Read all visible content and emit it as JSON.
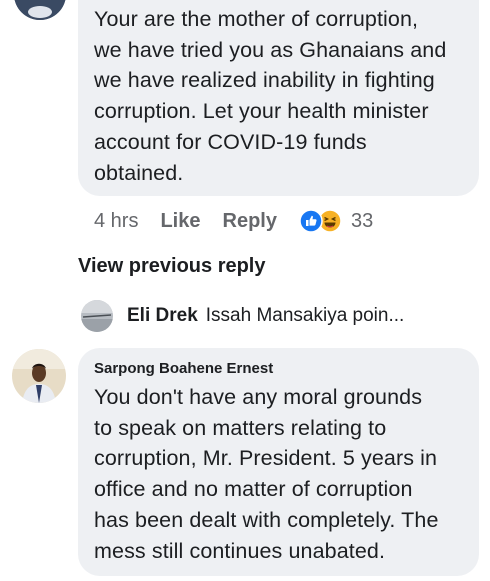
{
  "comment_1": {
    "lines": [
      "Your are the mother of corruption,",
      "we have tried you as Ghanaians and",
      "we have realized  inability in fighting",
      "corruption. Let your health minister",
      "account for COVID-19 funds",
      "obtained."
    ],
    "time": "4 hrs",
    "like_label": "Like",
    "reply_label": "Reply",
    "reaction_icons": [
      "like-reaction-icon",
      "haha-reaction-icon"
    ],
    "reaction_count": "33"
  },
  "view_previous_reply": "View previous reply",
  "collapsed_reply": {
    "author": "Eli Drek",
    "snippet": "Issah Mansakiya poin..."
  },
  "comment_2": {
    "author": "Sarpong Boahene Ernest",
    "lines": [
      "You don't have any moral grounds",
      "to speak on matters relating to",
      "corruption, Mr. President. 5 years in",
      "office and no matter of corruption",
      "has been dealt with completely. The",
      "mess still continues unabated."
    ]
  },
  "colors": {
    "bubble": "#eef0f3",
    "text": "#1c1e21",
    "meta": "#65676b",
    "like_blue": "#1877f2",
    "haha_yellow": "#f7b125"
  }
}
